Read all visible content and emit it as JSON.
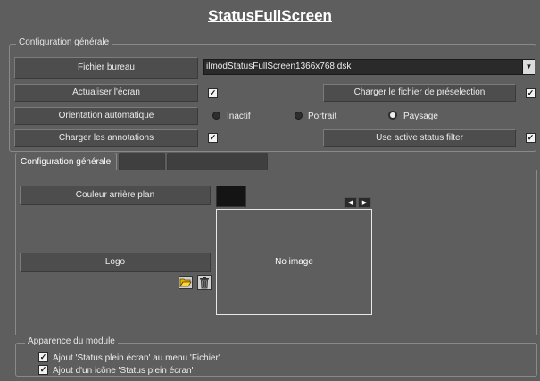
{
  "title": "StatusFullScreen",
  "general_config": {
    "legend": "Configuration générale",
    "desktop_file": {
      "label": "Fichier bureau",
      "value": "ilmodStatusFullScreen1366x768.dsk"
    },
    "refresh_screen": {
      "label": "Actualiser l'écran",
      "checked": true
    },
    "load_preselection": {
      "label": "Charger le fichier de préselection",
      "checked": true
    },
    "auto_orientation": {
      "label": "Orientation automatique",
      "options": [
        "Inactif",
        "Portrait",
        "Paysage"
      ],
      "selected": "Paysage"
    },
    "load_annotations": {
      "label": "Charger les annotations",
      "checked": true
    },
    "active_status_filter": {
      "label": "Use active status filter",
      "checked": true
    }
  },
  "tabs": [
    {
      "label": "Configuration générale",
      "active": true
    },
    {
      "label": "",
      "active": false
    },
    {
      "label": "",
      "active": false
    }
  ],
  "tab_panel": {
    "background_color_label": "Couleur arrière plan",
    "background_color": "#141414",
    "logo_label": "Logo",
    "no_image_text": "No image",
    "nav_prev": "◀",
    "nav_next": "▶",
    "open_icon": "folder-open-icon",
    "delete_icon": "trash-icon"
  },
  "module_appearance": {
    "legend": "Apparence du module",
    "options": [
      {
        "label": "Ajout 'Status plein écran' au menu 'Fichier'",
        "checked": true
      },
      {
        "label": "Ajout d'un icône 'Status plein écran'",
        "checked": true
      }
    ]
  },
  "check_mark": "✓",
  "combo_arrow": "▼"
}
